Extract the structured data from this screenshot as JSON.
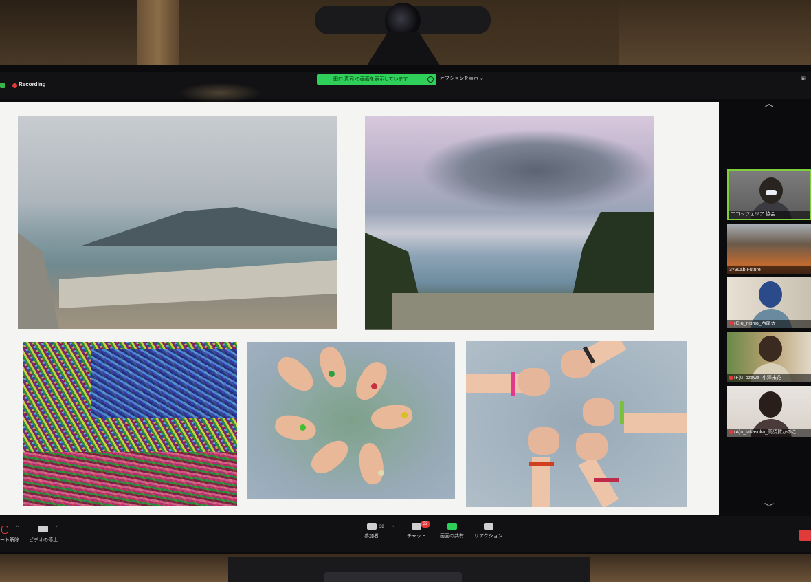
{
  "topbar": {
    "recording_label": "Recording",
    "share_banner": "田口 真司 の画面を表示しています",
    "view_options": "オプションを表示 ⌄"
  },
  "toolbar": {
    "mute_label": "ート解除",
    "video_label": "ビデオの停止",
    "participants_label": "参加者",
    "participants_count": "38",
    "chat_label": "チャット",
    "chat_badge": "23",
    "share_label": "画面の共有",
    "reactions_label": "リアクション"
  },
  "participants": [
    {
      "name": "エコッツェリア 協会",
      "active": true
    },
    {
      "name": "3×3Lab Future",
      "active": false
    },
    {
      "name": "(C)u_nishio_西尾太一",
      "active": false
    },
    {
      "name": "(F)u_ozawa_小澤未花",
      "active": false
    },
    {
      "name": "(A)u_takasuka_高須賀かのこ",
      "active": false
    }
  ],
  "colors": {
    "share_green": "#2ed05a",
    "active_border": "#7ed03a",
    "recording_red": "#e03a3a"
  }
}
